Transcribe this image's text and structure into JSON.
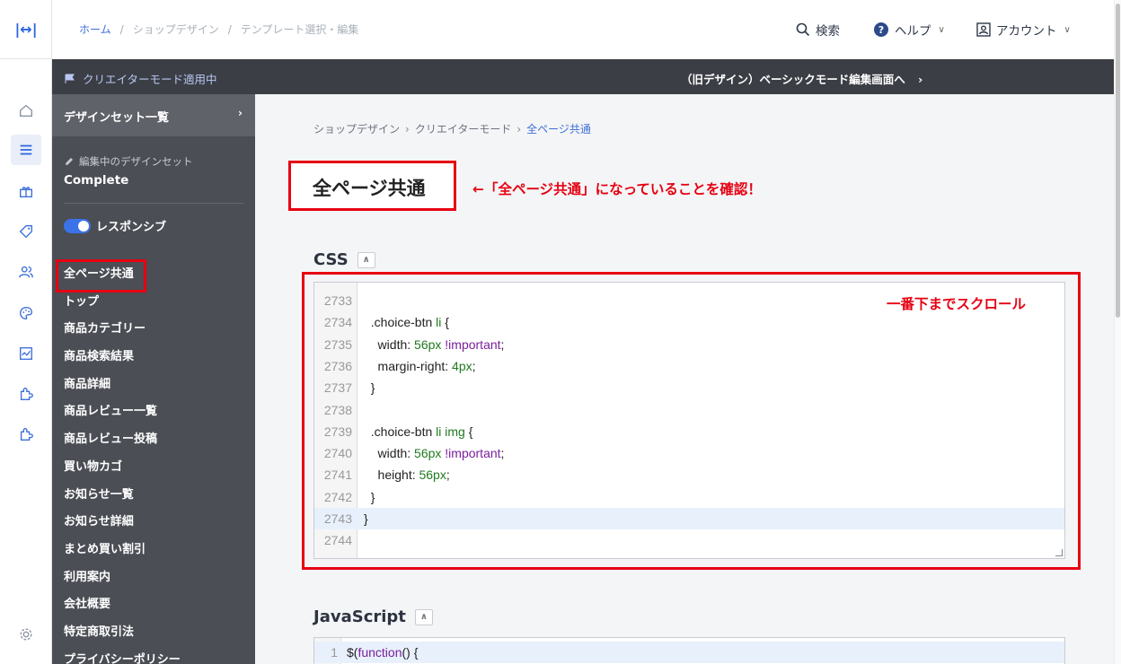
{
  "header": {
    "breadcrumb": [
      "ホーム",
      "ショップデザイン",
      "テンプレート選択・編集"
    ],
    "search_label": "検索",
    "help_label": "ヘルプ",
    "account_label": "アカウント"
  },
  "darkbar": {
    "creator_mode": "クリエイターモード適用中",
    "old_design_link": "（旧デザイン）ベーシックモード編集画面へ"
  },
  "sidebar": {
    "design_set_list": "デザインセット一覧",
    "editing_label": "編集中のデザインセット",
    "design_set_name": "Complete",
    "responsive_label": "レスポンシブ",
    "responsive_on": true,
    "pages": [
      {
        "label": "全ページ共通",
        "selected": true
      },
      {
        "label": "トップ"
      },
      {
        "label": "商品カテゴリー"
      },
      {
        "label": "商品検索結果"
      },
      {
        "label": "商品詳細"
      },
      {
        "label": "商品レビュー一覧"
      },
      {
        "label": "商品レビュー投稿"
      },
      {
        "label": "買い物カゴ"
      },
      {
        "label": "お知らせ一覧"
      },
      {
        "label": "お知らせ詳細"
      },
      {
        "label": "まとめ買い割引"
      },
      {
        "label": "利用案内"
      },
      {
        "label": "会社概要"
      },
      {
        "label": "特定商取引法"
      },
      {
        "label": "プライバシーポリシー"
      }
    ]
  },
  "main": {
    "breadcrumb": [
      "ショップデザイン",
      "クリエイターモード",
      "全ページ共通"
    ],
    "title": "全ページ共通",
    "annotation_title": "←「全ページ共通」になっていることを確認！",
    "annotation_scroll": "一番下までスクロール",
    "css_label": "CSS",
    "js_label": "JavaScript",
    "css_lines": [
      {
        "num": "2733",
        "code": ""
      },
      {
        "num": "2734",
        "code": "  .choice-btn li {"
      },
      {
        "num": "2735",
        "code": "    width: 56px !important;"
      },
      {
        "num": "2736",
        "code": "    margin-right: 4px;"
      },
      {
        "num": "2737",
        "code": "  }"
      },
      {
        "num": "2738",
        "code": ""
      },
      {
        "num": "2739",
        "code": "  .choice-btn li img {"
      },
      {
        "num": "2740",
        "code": "    width: 56px !important;"
      },
      {
        "num": "2741",
        "code": "    height: 56px;"
      },
      {
        "num": "2742",
        "code": "  }"
      },
      {
        "num": "2743",
        "code": "}"
      },
      {
        "num": "2744",
        "code": ""
      }
    ],
    "js_lines": [
      {
        "num": "1",
        "code": "$(function() {"
      }
    ]
  },
  "colors": {
    "accent": "#3a73e8",
    "annotation_red": "#e60012",
    "sidebar_bg": "#4b4e55"
  }
}
